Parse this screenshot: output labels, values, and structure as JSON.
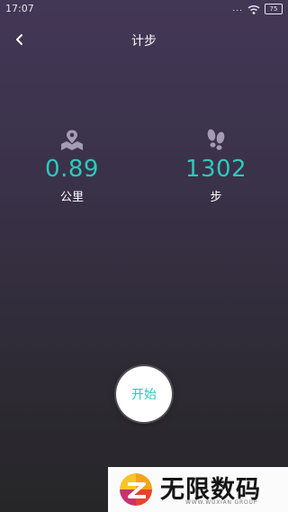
{
  "status_bar": {
    "time": "17:07",
    "signal_label": "...",
    "battery_level": "75",
    "icons": [
      "signal-dots-icon",
      "wifi-icon",
      "battery-icon"
    ]
  },
  "app_bar": {
    "title": "计步",
    "back_icon": "chevron-left-icon"
  },
  "stats": {
    "distance": {
      "icon": "map-pin-icon",
      "value": "0.89",
      "unit": "公里"
    },
    "steps": {
      "icon": "footprints-icon",
      "value": "1302",
      "unit": "步"
    }
  },
  "actions": {
    "start_label": "开始"
  },
  "watermark": {
    "title": "无限数码",
    "subtitle": "WWW.WUXIAN GROUP"
  },
  "colors": {
    "accent": "#2ec8bc",
    "background_top": "#433756",
    "background_bottom": "#262628",
    "icon": "#a59bb5"
  }
}
